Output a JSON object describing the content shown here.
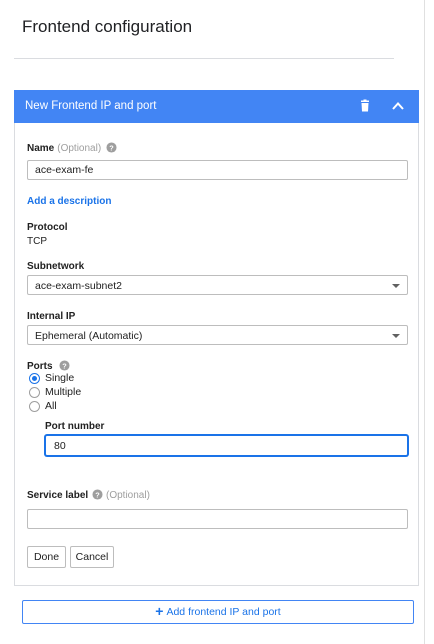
{
  "page": {
    "title": "Frontend configuration"
  },
  "panel": {
    "header_title": "New Frontend IP and port",
    "delete_icon": "trash-icon",
    "collapse_icon": "chevron-up-icon",
    "header_color": "#4285f4"
  },
  "name": {
    "label": "Name",
    "optional": "(Optional)",
    "value": "ace-exam-fe"
  },
  "add_description_link": "Add a description",
  "protocol": {
    "label": "Protocol",
    "value": "TCP"
  },
  "subnetwork": {
    "label": "Subnetwork",
    "selected": "ace-exam-subnet2"
  },
  "internal_ip": {
    "label": "Internal IP",
    "selected": "Ephemeral (Automatic)"
  },
  "ports": {
    "label": "Ports",
    "options": [
      "Single",
      "Multiple",
      "All"
    ],
    "selected": "Single"
  },
  "port_number": {
    "label": "Port number",
    "value": "80"
  },
  "service_label": {
    "label": "Service label",
    "optional": "(Optional)",
    "value": ""
  },
  "actions": {
    "done": "Done",
    "cancel": "Cancel"
  },
  "add_frontend": {
    "label": "Add frontend IP and port",
    "icon": "plus-icon",
    "accent": "#1a73e8"
  }
}
